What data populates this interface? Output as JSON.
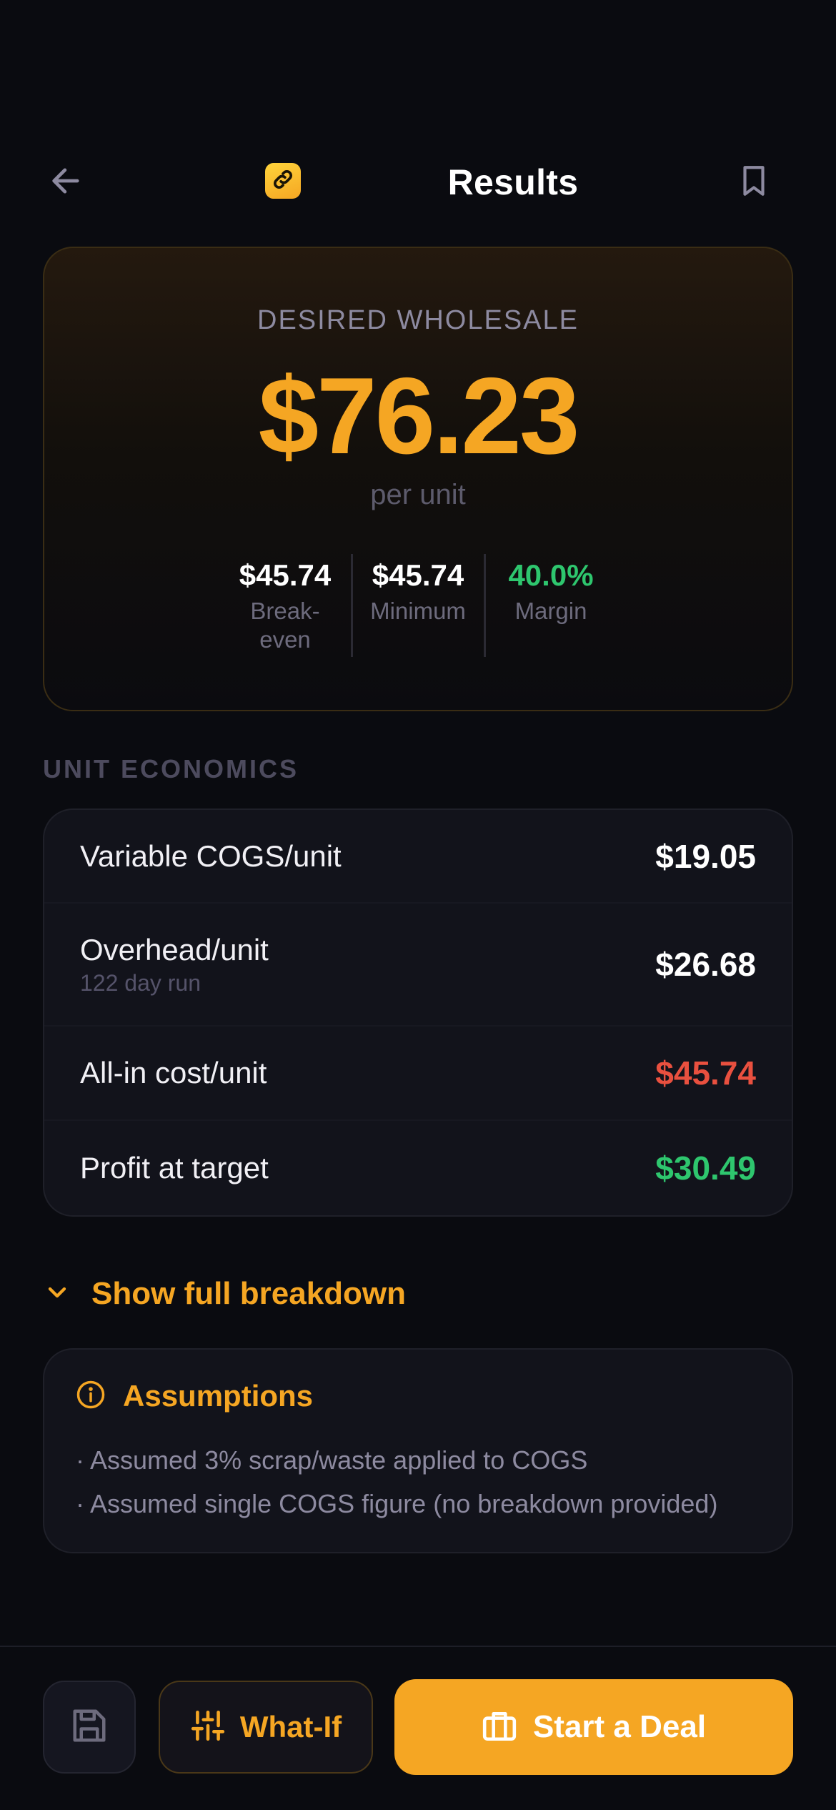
{
  "header": {
    "title": "Results",
    "icons": {
      "back": "arrow-left-icon",
      "logo": "link-icon",
      "bookmark": "bookmark-icon"
    }
  },
  "hero": {
    "label": "DESIRED WHOLESALE",
    "value": "$76.23",
    "unit": "per unit",
    "stats": [
      {
        "value": "$45.74",
        "label": "Break-even"
      },
      {
        "value": "$45.74",
        "label": "Minimum"
      },
      {
        "value": "40.0%",
        "label": "Margin"
      }
    ]
  },
  "unit_economics": {
    "title": "UNIT ECONOMICS",
    "rows": [
      {
        "label": "Variable COGS/unit",
        "sub": "",
        "value": "$19.05"
      },
      {
        "label": "Overhead/unit",
        "sub": "122 day run",
        "value": "$26.68"
      },
      {
        "label": "All-in cost/unit",
        "sub": "",
        "value": "$45.74"
      },
      {
        "label": "Profit at target",
        "sub": "",
        "value": "$30.49"
      }
    ]
  },
  "breakdown_toggle": {
    "label": "Show full breakdown",
    "icon": "chevron-down-icon"
  },
  "assumptions": {
    "title": "Assumptions",
    "icon": "info-icon",
    "items": [
      "· Assumed 3% scrap/waste applied to COGS",
      "· Assumed single COGS figure (no breakdown provided)"
    ]
  },
  "actions": {
    "save_icon": "save-icon",
    "whatif_label": "What-If",
    "whatif_icon": "sliders-icon",
    "deal_label": "Start a Deal",
    "deal_icon": "briefcase-icon"
  },
  "colors": {
    "accent": "#f5a623",
    "positive": "#2ec66e",
    "negative": "#e9503f",
    "background": "#0a0b10"
  }
}
